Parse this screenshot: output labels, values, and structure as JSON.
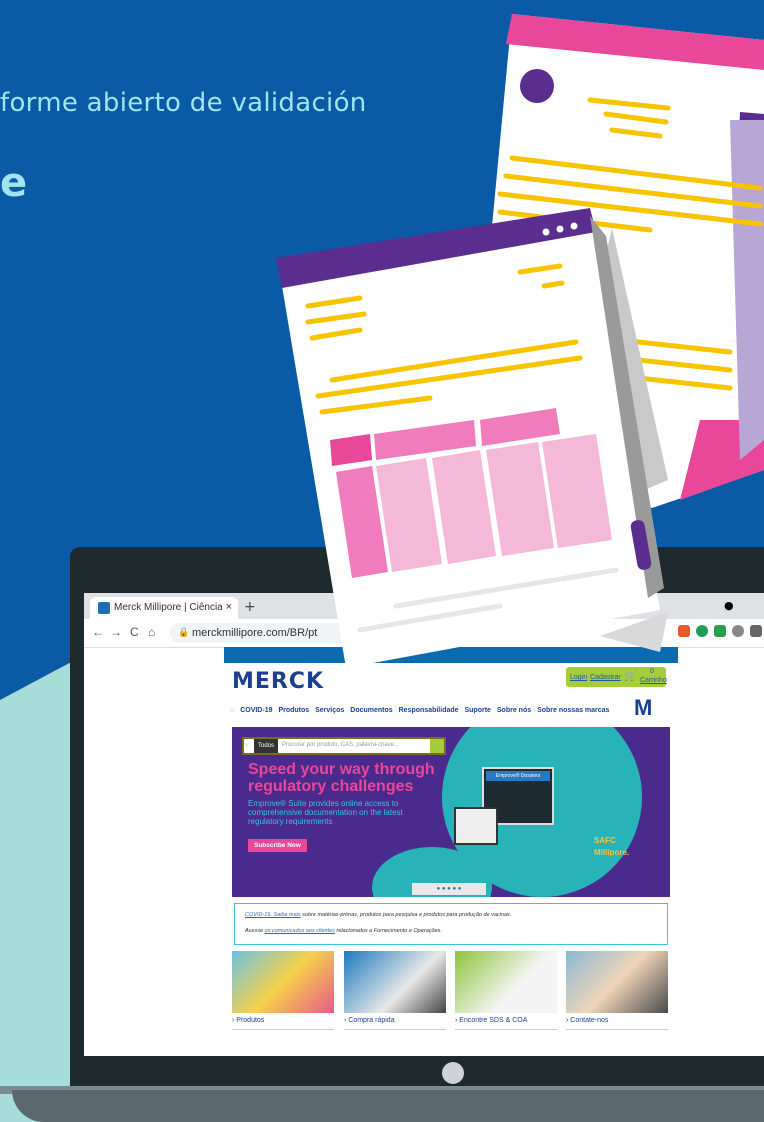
{
  "headline": "forme abierto de validación",
  "headline_partial": "e",
  "browser": {
    "tab_title": "Merck Millipore | Ciências da Vid",
    "tab_close": "×",
    "new_tab": "+",
    "url": "merckmillipore.com/BR/pt",
    "lock": "🔒",
    "nav_back": "←",
    "nav_forward": "→",
    "nav_reload": "C",
    "nav_home": "⌂"
  },
  "site": {
    "logo": "MERCK",
    "login": "Login",
    "register": "Cadastrar",
    "cart_count": "0",
    "cart_label": "Carrinho",
    "menu": [
      "COVID-19",
      "Produtos",
      "Serviços",
      "Documentos",
      "Responsabilidade",
      "Suporte",
      "Sobre nós",
      "Sobre nossas marcas"
    ],
    "search_scope": "Todos",
    "search_placeholder": "Procurar por produto, CAS, palavra-chave...",
    "hero_title": "Speed your way through regulatory challenges",
    "hero_text": "Emprove® Suite provides online access to comprehensive documentation on the latest regulatory requirements",
    "hero_button": "Subscribe Now",
    "dossier_label": "Emprove® Dossiers",
    "safc": "SAFC",
    "millipore": "Millipore.",
    "notice_line1_link": "COVID-19. Saiba mais",
    "notice_line1_rest": " sobre matérias-primas, produtos para pesquisa e produtos para produção de vacinas.",
    "notice_line2_pre": "Acesse ",
    "notice_line2_link": "os comunicados aos clientes",
    "notice_line2_rest": " relacionados a Fornecimento e Operações.",
    "cards": [
      "Produtos",
      "Compra rápida",
      "Encontre SDS & COA",
      "Contate-nos"
    ]
  },
  "colors": {
    "background": "#0b5aa6",
    "teal": "#a7ddd8",
    "magenta": "#e8479a",
    "purple": "#5b2d8e",
    "yellow": "#f7c400"
  }
}
